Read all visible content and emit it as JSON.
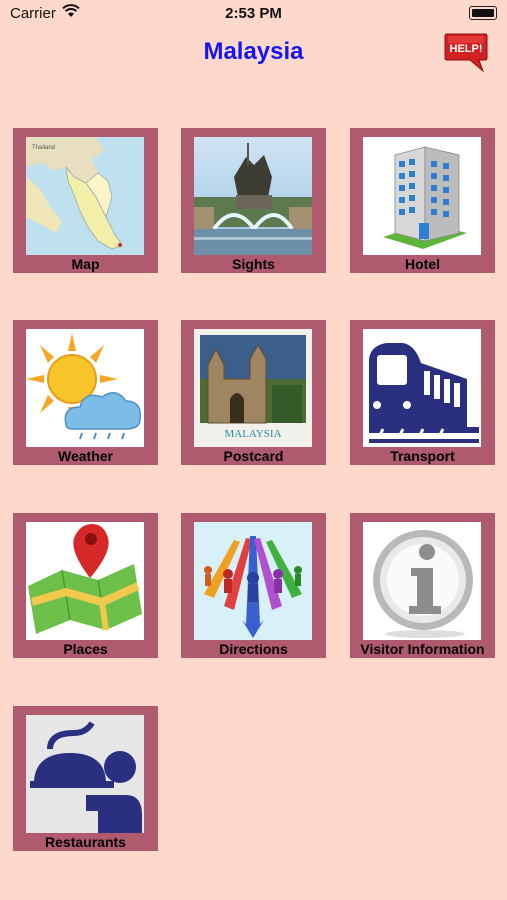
{
  "status_bar": {
    "carrier": "Carrier",
    "time": "2:53 PM"
  },
  "header": {
    "title": "Malaysia",
    "help_label": "HELP!"
  },
  "tiles": [
    {
      "label": "Map",
      "icon": "map-icon"
    },
    {
      "label": "Sights",
      "icon": "monument-fountain-icon"
    },
    {
      "label": "Hotel",
      "icon": "hotel-building-icon"
    },
    {
      "label": "Weather",
      "icon": "sun-cloud-icon"
    },
    {
      "label": "Postcard",
      "icon": "postcard-icon",
      "caption": "MALAYSIA"
    },
    {
      "label": "Transport",
      "icon": "train-icon"
    },
    {
      "label": "Places",
      "icon": "map-pin-icon"
    },
    {
      "label": "Directions",
      "icon": "directions-arrows-icon"
    },
    {
      "label": "Visitor Information",
      "icon": "info-icon"
    },
    {
      "label": "Restaurants",
      "icon": "waiter-cloche-icon"
    }
  ],
  "colors": {
    "background": "#ffd8cc",
    "tile_border": "#b05a6f",
    "title": "#1515ee",
    "help_red": "#d32020"
  }
}
